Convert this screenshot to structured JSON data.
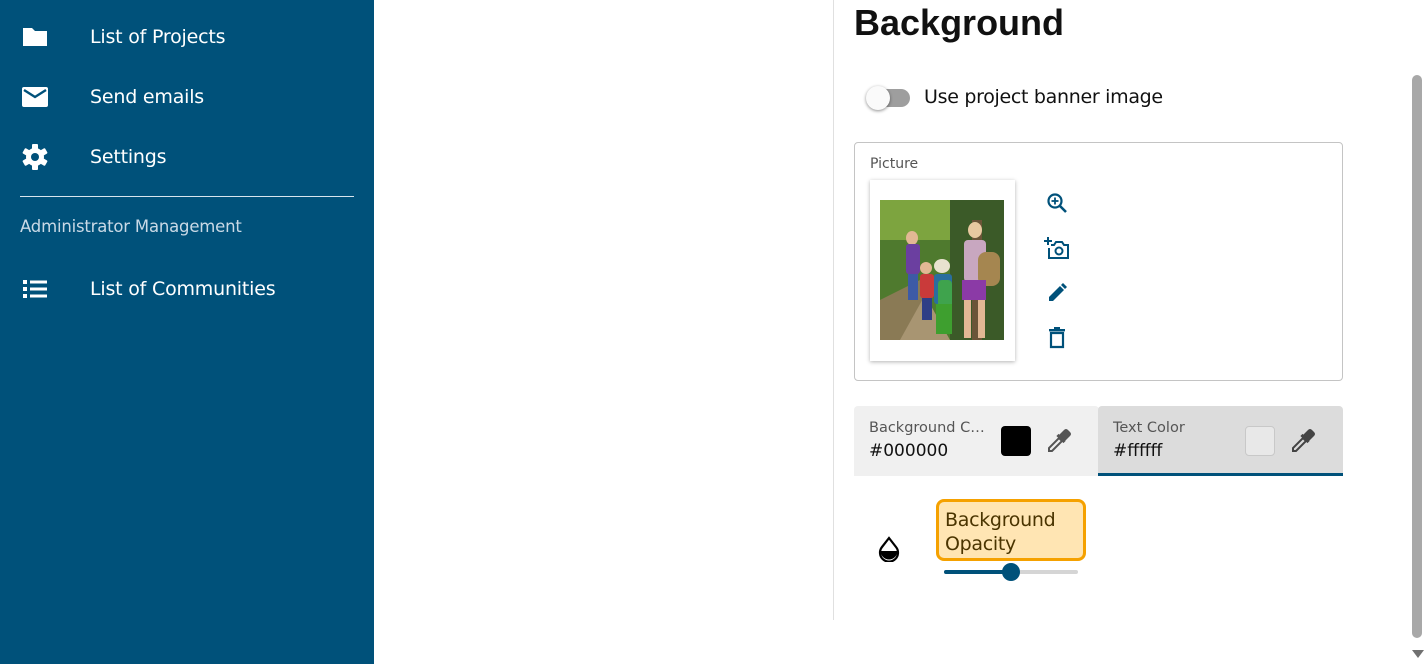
{
  "sidebar": {
    "items": [
      {
        "label": "List of Projects",
        "icon": "folder-icon"
      },
      {
        "label": "Send emails",
        "icon": "mail-icon"
      },
      {
        "label": "Settings",
        "icon": "gear-icon"
      }
    ],
    "section_label": "Administrator Management",
    "admin_items": [
      {
        "label": "List of Communities",
        "icon": "list-icon"
      }
    ]
  },
  "main": {
    "title": "Background",
    "banner_toggle": {
      "label": "Use project banner image",
      "checked": false
    },
    "picture": {
      "label": "Picture",
      "actions": [
        "zoom-in-icon",
        "add-photo-icon",
        "edit-pencil-icon",
        "delete-trash-icon"
      ]
    },
    "background_color": {
      "label": "Background Co...",
      "value": "#000000"
    },
    "text_color": {
      "label": "Text Color",
      "value": "#ffffff"
    },
    "opacity": {
      "label": "Background Opacity",
      "value": 0.5
    }
  },
  "colors": {
    "sidebar": "#00517a",
    "accent": "#00517a",
    "highlight_border": "#f5a100",
    "highlight_fill": "#ffe5b3"
  }
}
